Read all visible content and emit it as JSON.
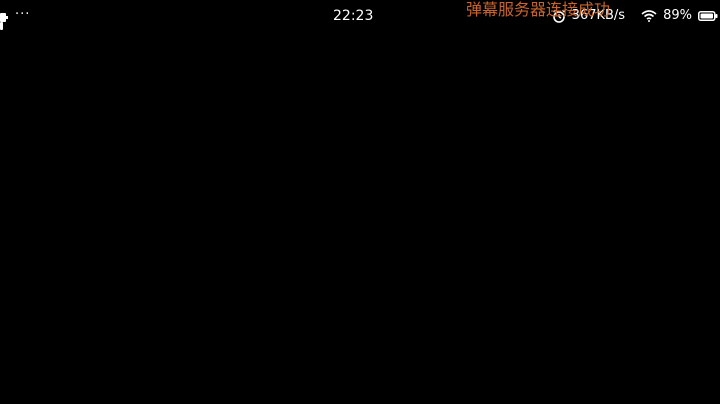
{
  "status_bar": {
    "more_dots": "···",
    "time": "22:23",
    "network_speed": "367KB/s",
    "battery_percent": "89%"
  },
  "overlay": {
    "danmaku_message": "弹幕服务器连接成功"
  },
  "colors": {
    "background": "#000000",
    "status_text": "#ffffff",
    "danmaku_text": "#c8642c"
  }
}
